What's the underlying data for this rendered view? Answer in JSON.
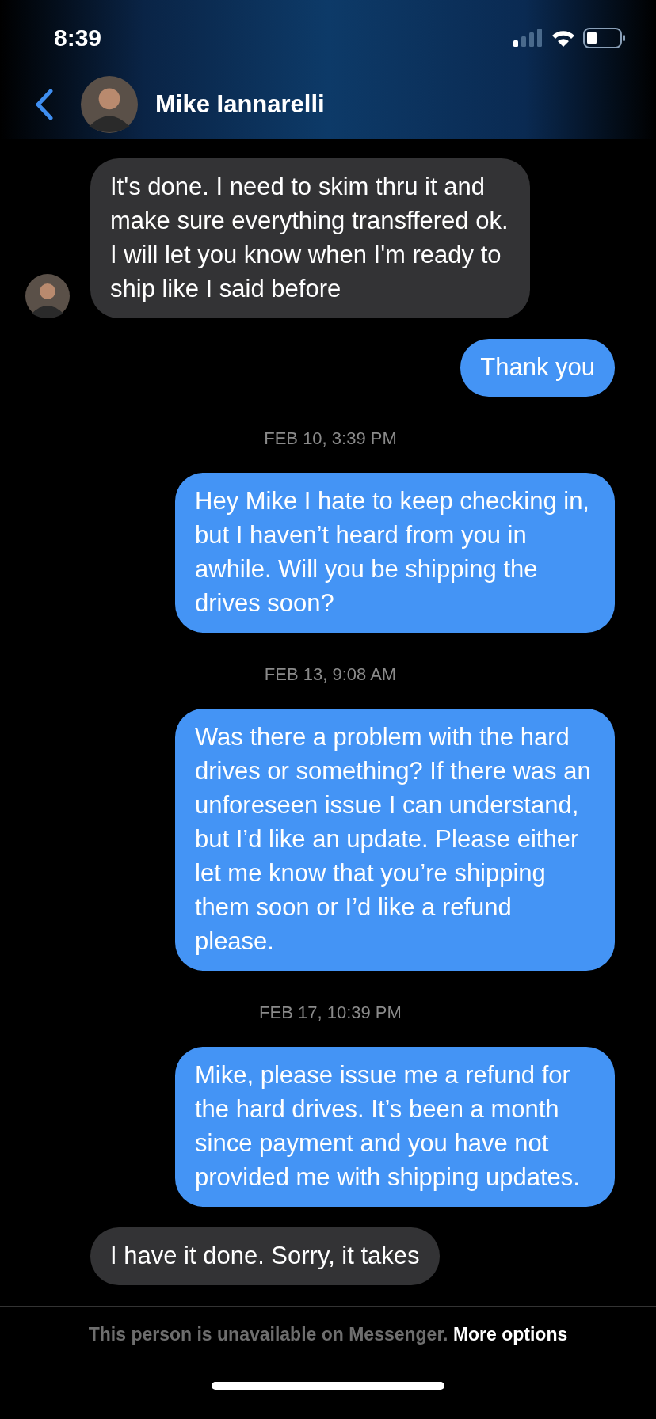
{
  "status_bar": {
    "time": "8:39"
  },
  "header": {
    "contact_name": "Mike Iannarelli"
  },
  "messages": [
    {
      "kind": "incoming",
      "show_avatar": true,
      "text": "It's done. I need to skim thru it and make sure everything transffered ok. I will let you know when I'm ready to ship like I said before"
    },
    {
      "kind": "outgoing",
      "text": "Thank you"
    },
    {
      "kind": "timestamp",
      "text": "FEB 10, 3:39 PM"
    },
    {
      "kind": "outgoing",
      "text": "Hey Mike I hate to keep checking in, but I haven’t heard from you in awhile. Will you be shipping the drives soon?"
    },
    {
      "kind": "timestamp",
      "text": "FEB 13, 9:08 AM"
    },
    {
      "kind": "outgoing",
      "text": "Was there a problem with the hard drives or something?  If there was an unforeseen issue I can understand, but I’d like an update. Please either let me know that you’re shipping them soon or I’d like a refund please."
    },
    {
      "kind": "timestamp",
      "text": "FEB 17, 10:39 PM"
    },
    {
      "kind": "outgoing",
      "text": "Mike, please issue me a refund for the hard drives. It’s been a month since payment and you have not provided me with shipping updates."
    },
    {
      "kind": "incoming",
      "show_avatar": false,
      "text": "I have it done. Sorry, it takes"
    }
  ],
  "footer": {
    "notice": "This person is unavailable on Messenger.",
    "link": "More options"
  }
}
